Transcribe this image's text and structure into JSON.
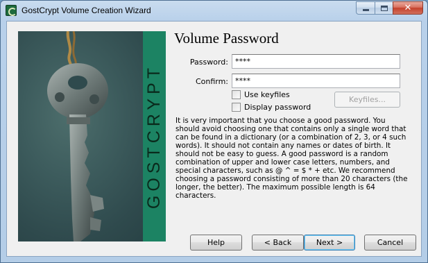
{
  "window": {
    "title": "GostCrypt Volume Creation Wizard",
    "app_icon": "gostcrypt-app-icon",
    "controls": {
      "minimize_icon": "minimize-icon",
      "maximize_icon": "maximize-icon",
      "close_glyph": "✕"
    }
  },
  "side_image": {
    "brand_text": "GOSTCRYPT",
    "brand_color": "#1c8363"
  },
  "page": {
    "heading": "Volume Password",
    "password": {
      "label": "Password:",
      "value": "****"
    },
    "confirm": {
      "label": "Confirm:",
      "value": "****"
    },
    "use_keyfiles": {
      "label": "Use keyfiles",
      "checked": false
    },
    "display_password": {
      "label": "Display password",
      "checked": false
    },
    "keyfiles_button": "Keyfiles...",
    "info_text": "It is very important that you choose a good password. You should avoid choosing one that contains only a single word that can be found in a dictionary (or a combination of 2, 3, or 4 such words). It should not contain any names or dates of birth. It should not be easy to guess. A good password is a random combination of upper and lower case letters, numbers, and special characters, such as @ ^ = $ * + etc. We recommend choosing a password consisting of more than 20 characters (the longer, the better). The maximum possible length is 64 characters."
  },
  "footer": {
    "help": "Help",
    "back": "< Back",
    "next": "Next >",
    "cancel": "Cancel"
  }
}
